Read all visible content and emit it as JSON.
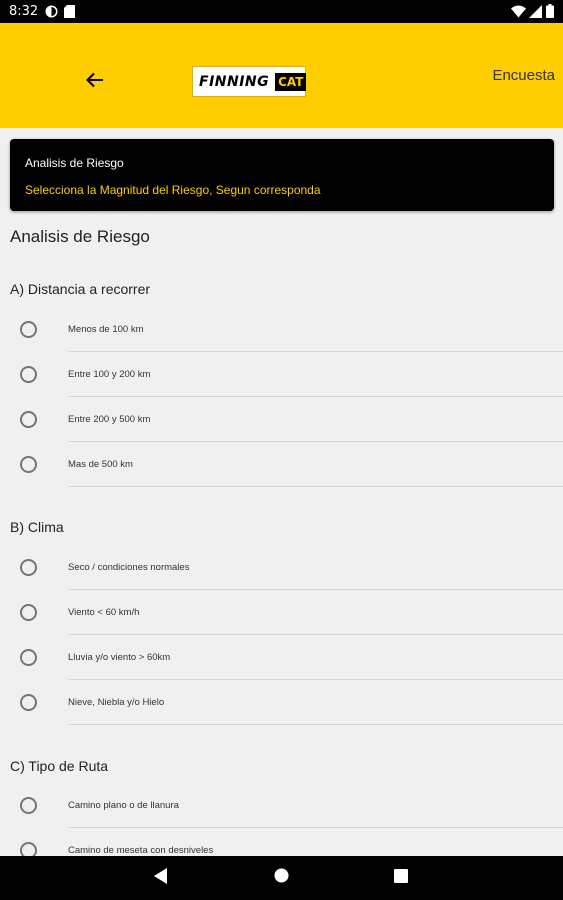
{
  "status_bar": {
    "time": "8:32",
    "left_icons": [
      "circle-status-icon",
      "sd-card-icon"
    ],
    "right_icons": [
      "wifi-icon",
      "cellular-icon",
      "battery-icon"
    ]
  },
  "app_bar": {
    "logo_word": "FINNING",
    "logo_mark": "CAT",
    "title": "Encuesta",
    "color": "#ffcd00"
  },
  "banner": {
    "title": "Analisis de Riesgo",
    "subtitle": "Selecciona la Magnitud del Riesgo, Segun corresponda"
  },
  "page_title": "Analisis de Riesgo",
  "sections": [
    {
      "title": "A) Distancia a recorrer",
      "options": [
        "Menos de 100 km",
        "Entre 100 y 200 km",
        "Entre 200 y 500 km",
        "Mas de 500 km"
      ]
    },
    {
      "title": "B) Clima",
      "options": [
        "Seco / condiciones normales",
        "Viento < 60 km/h",
        "Lluvia y/o viento > 60km",
        "Nieve, Niebla y/o Hielo"
      ]
    },
    {
      "title": "C) Tipo de Ruta",
      "options": [
        "Camino plano o de llanura",
        "Camino de meseta con desniveles"
      ]
    }
  ],
  "nav_bar": [
    "back-triangle-icon",
    "home-circle-icon",
    "recents-square-icon"
  ]
}
